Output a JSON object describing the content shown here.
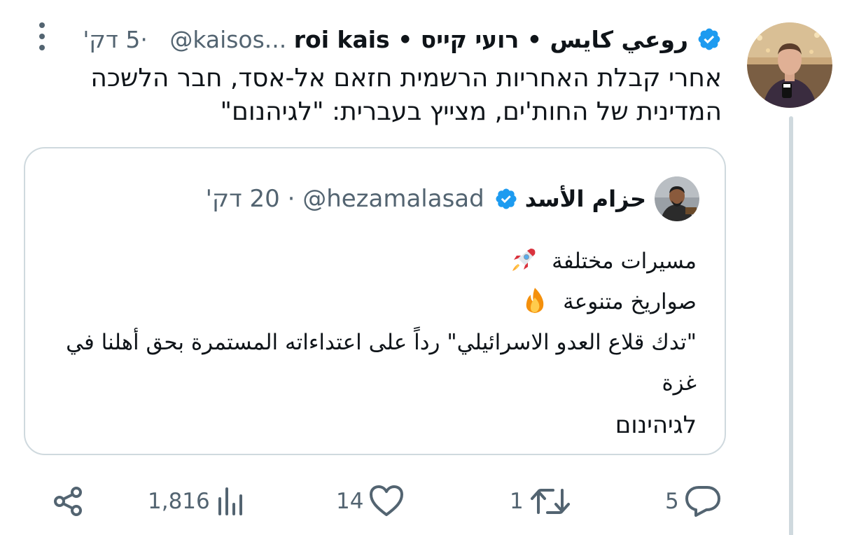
{
  "tweet": {
    "author": {
      "display_name_parts": [
        "רועי קייס",
        "roi kais",
        "روعي كايس"
      ],
      "separator": "•",
      "handle": "@kaisos...",
      "time": "5 דק'",
      "dot": "·",
      "verified": true
    },
    "text": "אחרי קבלת האחריות הרשמית חזאם אל-אסד, חבר הלשכה המדינית של החות'ים, מצייץ בעברית: \"לגיהנום\"",
    "quote": {
      "author_name": "حزام الأسد",
      "handle": "@hezamalasad",
      "dot": "·",
      "time": "20 דק'",
      "verified": true,
      "lines": [
        "مسيرات مختلفة",
        "صواريخ متنوعة",
        "\"تدك قلاع العدو الاسرائيلي\" رداً على اعتداءاته المستمرة بحق أهلنا في غزة",
        "לגיהינום"
      ],
      "emojis": [
        "rocket-emoji",
        "fire-emoji"
      ]
    },
    "actions": {
      "replies": "5",
      "retweets": "1",
      "likes": "14",
      "views": "1,816"
    }
  },
  "colors": {
    "verified_blue": "#1d9bf0",
    "secondary_text": "#536471",
    "border": "#cfd9de",
    "thread_line": "#cfd9de"
  },
  "icons": [
    "more-icon",
    "verified-icon",
    "share-icon",
    "views-icon",
    "like-icon",
    "retweet-icon",
    "reply-icon"
  ]
}
